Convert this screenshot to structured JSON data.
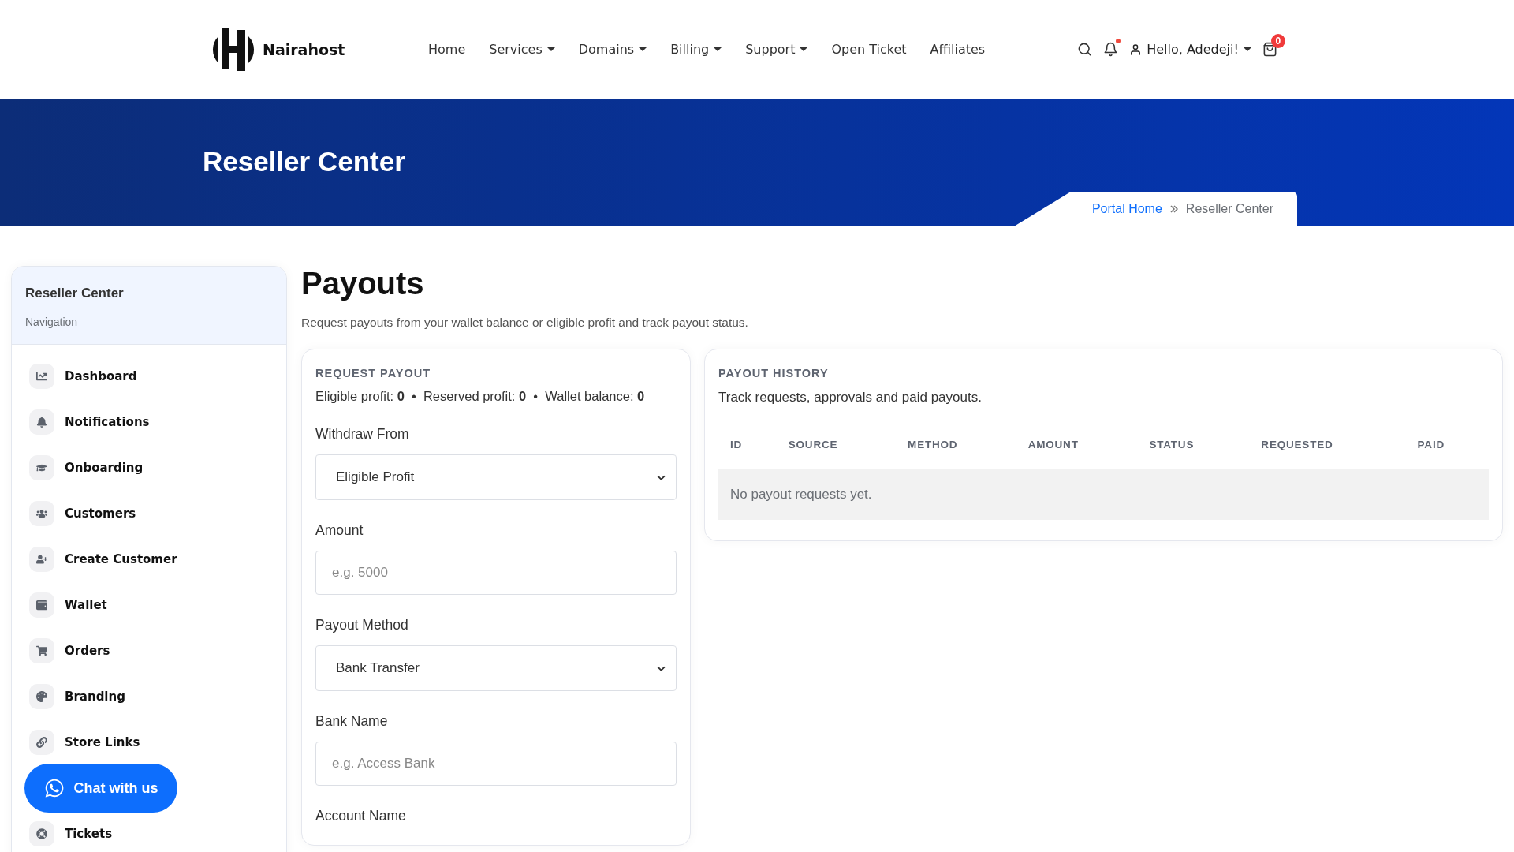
{
  "header": {
    "brand": "Nairahost",
    "nav": [
      {
        "label": "Home",
        "dropdown": false
      },
      {
        "label": "Services",
        "dropdown": true
      },
      {
        "label": "Domains",
        "dropdown": true
      },
      {
        "label": "Billing",
        "dropdown": true
      },
      {
        "label": "Support",
        "dropdown": true
      },
      {
        "label": "Open Ticket",
        "dropdown": false
      },
      {
        "label": "Affiliates",
        "dropdown": false
      }
    ],
    "user": "Hello, Adedeji!",
    "cart_count": "0"
  },
  "banner": {
    "title": "Reseller Center",
    "breadcrumb": [
      {
        "label": "Portal Home",
        "selected": false
      },
      {
        "label": "Reseller Center",
        "selected": true
      }
    ]
  },
  "sidebar": {
    "title": "Reseller Center",
    "subtitle": "Navigation",
    "items": [
      {
        "label": "Dashboard"
      },
      {
        "label": "Notifications"
      },
      {
        "label": "Onboarding"
      },
      {
        "label": "Customers"
      },
      {
        "label": "Create Customer"
      },
      {
        "label": "Wallet"
      },
      {
        "label": "Orders"
      },
      {
        "label": "Branding"
      },
      {
        "label": "Store Links"
      },
      {
        "label": "Tickets"
      }
    ]
  },
  "chat_button": "Chat with us",
  "page": {
    "title": "Payouts",
    "subtitle": "Request payouts from your wallet balance or eligible profit and track payout status."
  },
  "request_payout": {
    "heading": "REQUEST PAYOUT",
    "summary": "Eligible profit: **0**  •  Reserved profit: **0**  •  Wallet balance: **0**",
    "fields": [
      {
        "label": "Withdraw From",
        "kind": "select",
        "value": "Eligible Profit"
      },
      {
        "label": "Amount",
        "kind": "input",
        "placeholder": "e.g. 5000"
      },
      {
        "label": "Payout Method",
        "kind": "select",
        "value": "Bank Transfer"
      },
      {
        "label": "Bank Name",
        "kind": "input",
        "placeholder": "e.g. Access Bank"
      },
      {
        "label": "Account Name",
        "kind": "label"
      }
    ]
  },
  "payout_history": {
    "heading": "PAYOUT HISTORY",
    "description": "Track requests, approvals and paid payouts.",
    "table": {
      "columns": [
        "ID",
        "SOURCE",
        "METHOD",
        "AMOUNT",
        "STATUS",
        "REQUESTED",
        "PAID"
      ],
      "empty": "No payout requests yet."
    }
  }
}
